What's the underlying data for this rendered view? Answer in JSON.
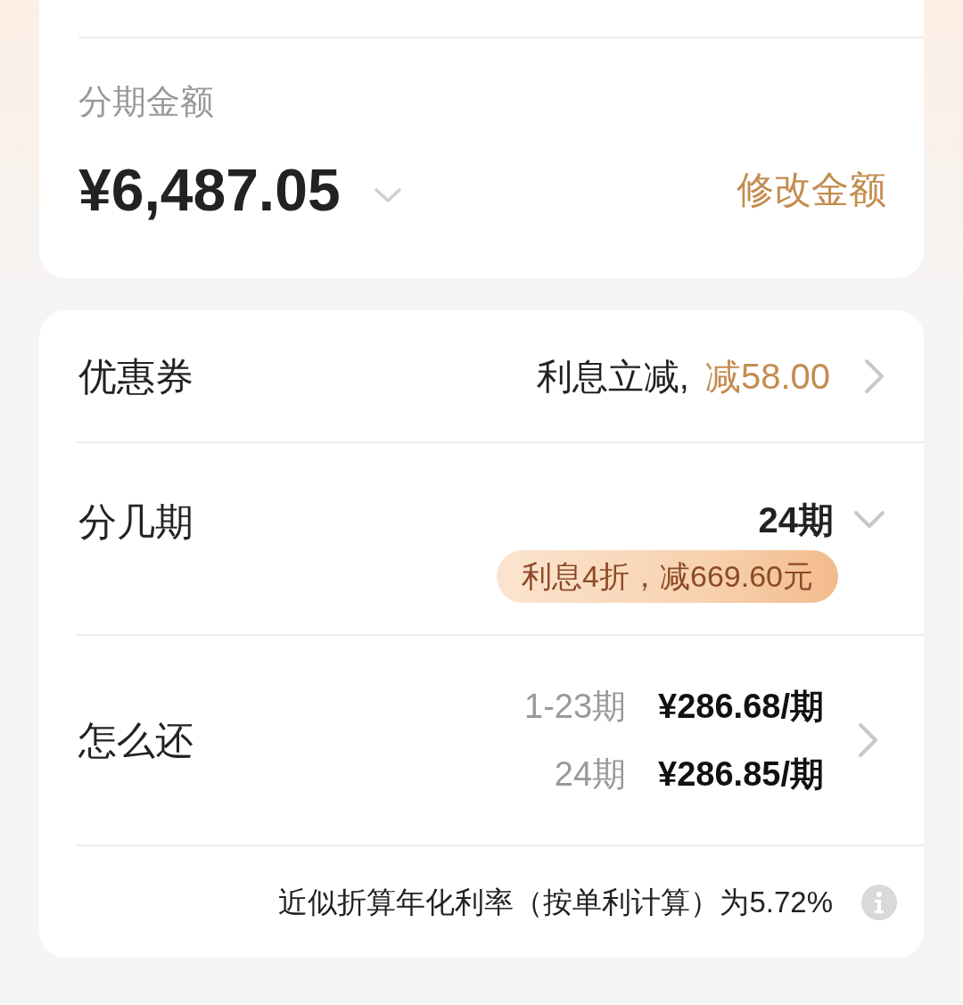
{
  "amount_card": {
    "label": "分期金额",
    "amount": "¥6,487.05",
    "edit_link": "修改金额"
  },
  "options_card": {
    "rows": [
      {
        "kind": "coupon",
        "label": "优惠券",
        "value": "利息立减,",
        "highlight": "减58.00"
      },
      {
        "kind": "term",
        "label": "分几期",
        "value": "24期",
        "badge": "利息4折，减669.60元"
      },
      {
        "kind": "repayment",
        "label": "怎么还",
        "schedule": [
          {
            "period": "1-23期",
            "amount": "¥286.68/期"
          },
          {
            "period": "24期",
            "amount": "¥286.85/期"
          }
        ]
      }
    ],
    "footnote": "近似折算年化利率（按单利计算）为5.72%"
  }
}
